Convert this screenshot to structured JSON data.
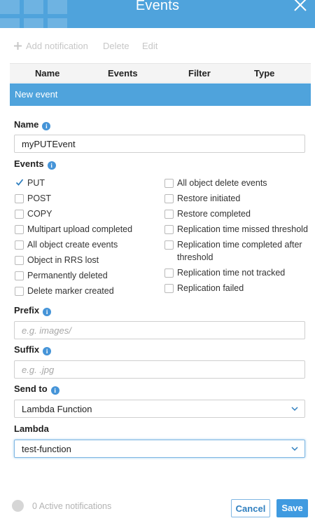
{
  "header": {
    "title": "Events"
  },
  "toolbar": {
    "add_label": "Add notification",
    "delete_label": "Delete",
    "edit_label": "Edit"
  },
  "table": {
    "columns": [
      "Name",
      "Events",
      "Filter",
      "Type"
    ]
  },
  "new_event": {
    "label": "New event"
  },
  "name_field": {
    "label": "Name",
    "value": "myPUTEvent"
  },
  "events": {
    "label": "Events",
    "left": [
      {
        "label": "PUT",
        "checked": true
      },
      {
        "label": "POST",
        "checked": false
      },
      {
        "label": "COPY",
        "checked": false
      },
      {
        "label": "Multipart upload completed",
        "checked": false
      },
      {
        "label": "All object create events",
        "checked": false
      },
      {
        "label": "Object in RRS lost",
        "checked": false
      },
      {
        "label": "Permanently deleted",
        "checked": false
      },
      {
        "label": "Delete marker created",
        "checked": false
      }
    ],
    "right": [
      {
        "label": "All object delete events",
        "checked": false
      },
      {
        "label": "Restore initiated",
        "checked": false
      },
      {
        "label": "Restore completed",
        "checked": false
      },
      {
        "label": "Replication time missed threshold",
        "checked": false
      },
      {
        "label": "Replication time completed after",
        "label2": "threshold",
        "checked": false
      },
      {
        "label": "Replication time not tracked",
        "checked": false
      },
      {
        "label": "Replication failed",
        "checked": false
      }
    ]
  },
  "prefix": {
    "label": "Prefix",
    "placeholder": "e.g. images/"
  },
  "suffix": {
    "label": "Suffix",
    "placeholder": "e.g. .jpg"
  },
  "send_to": {
    "label": "Send to",
    "value": "Lambda Function"
  },
  "lambda": {
    "label": "Lambda",
    "value": "test-function"
  },
  "footer": {
    "active_notifications": "0 Active notifications",
    "cancel_label": "Cancel",
    "save_label": "Save"
  },
  "colors": {
    "accent": "#4fa3dc",
    "button": "#3f9ae0",
    "info_icon": "#4594d8"
  }
}
